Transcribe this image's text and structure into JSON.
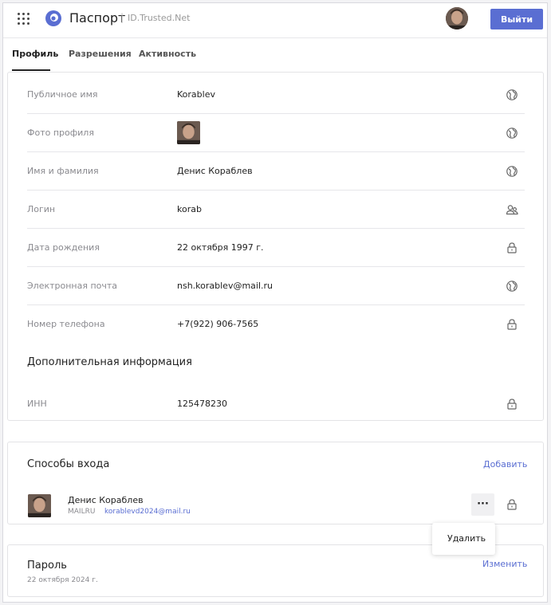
{
  "header": {
    "title": "Паспорт",
    "separator": "|",
    "subtitle": "ID.Trusted.Net",
    "logout_label": "Выйти"
  },
  "tabs": [
    {
      "label": "Профиль",
      "active": true
    },
    {
      "label": "Разрешения",
      "active": false
    },
    {
      "label": "Активность",
      "active": false
    }
  ],
  "profile": {
    "rows": [
      {
        "label": "Публичное имя",
        "value": "Korablev",
        "icon": "globe-icon"
      },
      {
        "label": "Фото профиля",
        "value": "",
        "icon": "globe-icon"
      },
      {
        "label": "Имя и фамилия",
        "value": "Денис Кораблев",
        "icon": "globe-icon"
      },
      {
        "label": "Логин",
        "value": "korab",
        "icon": "users-icon"
      },
      {
        "label": "Дата рождения",
        "value": "22 октября 1997 г.",
        "icon": "lock-icon"
      },
      {
        "label": "Электронная почта",
        "value": "nsh.korablev@mail.ru",
        "icon": "globe-icon"
      },
      {
        "label": "Номер телефона",
        "value": "+7(922) 906-7565",
        "icon": "lock-icon"
      }
    ],
    "additional_title": "Дополнительная информация",
    "additional_rows": [
      {
        "label": "ИНН",
        "value": "125478230",
        "icon": "lock-icon"
      }
    ]
  },
  "login_methods": {
    "title": "Способы входа",
    "add_label": "Добавить",
    "items": [
      {
        "name": "Денис Кораблев",
        "provider": "MAILRU",
        "email": "korablevd2024@mail.ru",
        "more_label": "···"
      }
    ],
    "menu": {
      "delete_label": "Удалить"
    }
  },
  "password": {
    "title": "Пароль",
    "date": "22 октября 2024 г.",
    "change_label": "Изменить"
  },
  "colors": {
    "accent": "#5a6ed2",
    "label": "#8a8a8f",
    "divider": "#e6e6ea"
  }
}
